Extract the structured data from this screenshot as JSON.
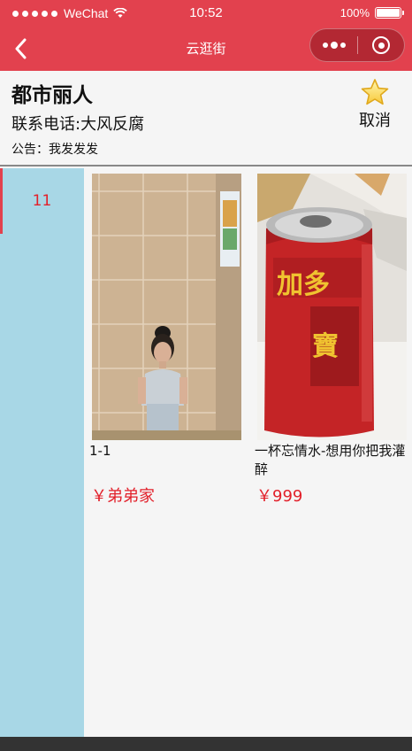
{
  "status_bar": {
    "carrier": "WeChat",
    "time": "10:52",
    "battery": "100%",
    "battery_level": 1.0
  },
  "nav": {
    "title": "云逛街"
  },
  "shop": {
    "name": "都市丽人",
    "phone": "联系电话:大风反腐",
    "notice": "公告：我发发发",
    "favorite_label": "取消"
  },
  "sidebar": {
    "items": [
      {
        "label": "11",
        "active": true
      }
    ]
  },
  "products": [
    {
      "name": "1-1",
      "price": "￥弟弟家",
      "image": "photo of a little girl standing by a tiled wall"
    },
    {
      "name": "一杯忘情水-想用你把我灌醉",
      "price": "￥999",
      "image": "photo of a red 加多宝 drink can"
    }
  ],
  "colors": {
    "accent": "#e2414e",
    "sidebar_bg": "#a8d7e6",
    "price": "#e2202a"
  },
  "icons": [
    "back-icon",
    "more-icon",
    "close-mini-program-icon",
    "star-icon",
    "wifi-icon",
    "battery-icon"
  ]
}
